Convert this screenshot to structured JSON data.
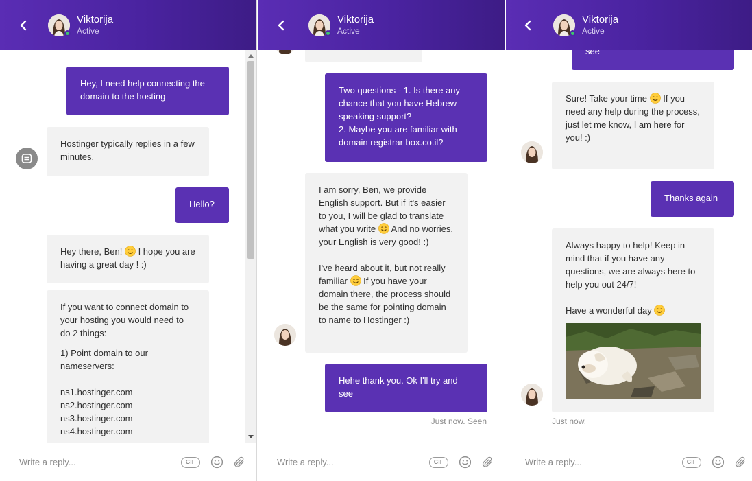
{
  "agent": {
    "name": "Viktorija",
    "status": "Active"
  },
  "composer": {
    "placeholder": "Write a reply...",
    "gif_label": "GIF"
  },
  "panel1": {
    "msg1": "Hey, I need help connecting the domain to the hosting",
    "msg2": "Hostinger typically replies in a few minutes.",
    "msg3": "Hello?",
    "msg4_a": "Hey there, Ben!",
    "msg4_b": "I hope you are having a great day ! :)",
    "msg5_p1": "If you want to connect domain to your hosting you would need to do 2 things:",
    "msg5_p2": "1) Point domain to our nameservers:",
    "msg5_ns": [
      "ns1.hostinger.com",
      "ns2.hostinger.com",
      "ns3.hostinger.com",
      "ns4.hostinger.com"
    ]
  },
  "panel2": {
    "msg1_l1": "Two questions - 1. Is there any chance that you have Hebrew speaking support?",
    "msg1_l2": "2. Maybe you are familiar with domain registrar box.co.il?",
    "msg2_p1a": "I am sorry, Ben, we provide English support. But if it's easier to you, I will be glad to translate what you write",
    "msg2_p1b": "And no worries, your English is very good! :)",
    "msg2_p2a": "I've heard about it, but not really familiar",
    "msg2_p2b": "If you have your domain there, the process should be the same for pointing domain to name to Hostinger :)",
    "msg3": "Hehe thank you. Ok I'll try and see",
    "meta": "Just now. Seen"
  },
  "panel3": {
    "msg0_tail": "see",
    "msg1_a": "Sure! Take your time",
    "msg1_b": "If you need any help during the process, just let me know, I am here for you! :)",
    "msg2": "Thanks again",
    "msg3_p1": "Always happy to help! Keep in mind that if you have any questions, we are always here to help you out 24/7!",
    "msg3_p2": "Have a wonderful day",
    "meta": "Just now."
  }
}
